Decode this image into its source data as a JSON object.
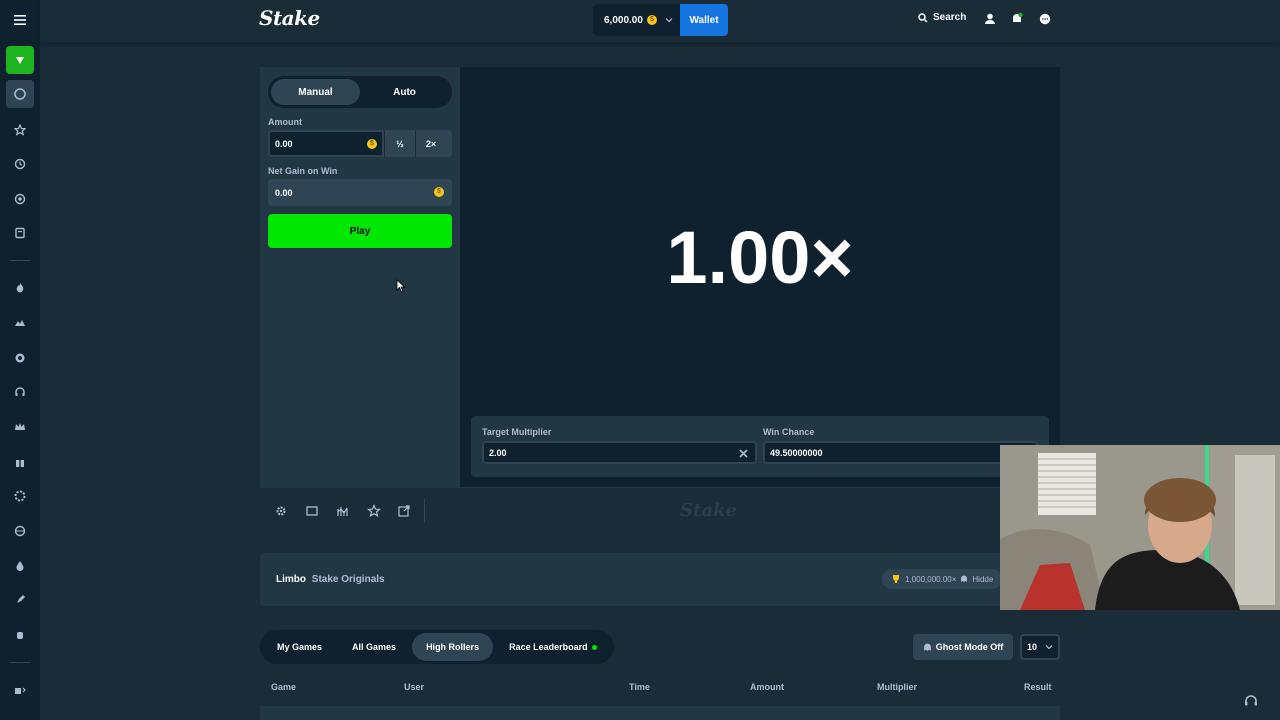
{
  "header": {
    "logo": "Stake",
    "balance": "6,000.00",
    "wallet_label": "Wallet",
    "search_label": "Search"
  },
  "bet_panel": {
    "mode_tabs": [
      "Manual",
      "Auto"
    ],
    "active_mode": "Manual",
    "amount_label": "Amount",
    "amount_value": "0.00",
    "half_label": "½",
    "double_label": "2×",
    "net_gain_label": "Net Gain on Win",
    "net_gain_value": "0.00",
    "play_label": "Play"
  },
  "game": {
    "multiplier_display": "1.00×",
    "target_multiplier_label": "Target Multiplier",
    "target_multiplier_value": "2.00",
    "win_chance_label": "Win Chance",
    "win_chance_value": "49.50000000",
    "footer_logo": "Stake"
  },
  "info": {
    "game_name": "Limbo",
    "provider": "Stake Originals",
    "max_win": "1,000,000.00×",
    "hidden_label": "Hidde"
  },
  "bets_tabs": {
    "tabs": [
      "My Games",
      "All Games",
      "High Rollers",
      "Race Leaderboard"
    ],
    "active_tab": "High Rollers",
    "ghost_mode_label": "Ghost Mode Off",
    "row_count": "10"
  },
  "table": {
    "columns": [
      "Game",
      "User",
      "Time",
      "Amount",
      "Multiplier",
      "Result"
    ]
  },
  "colors": {
    "play_green": "#00e701",
    "wallet_blue": "#1475e1",
    "bg": "#1a2c38"
  }
}
